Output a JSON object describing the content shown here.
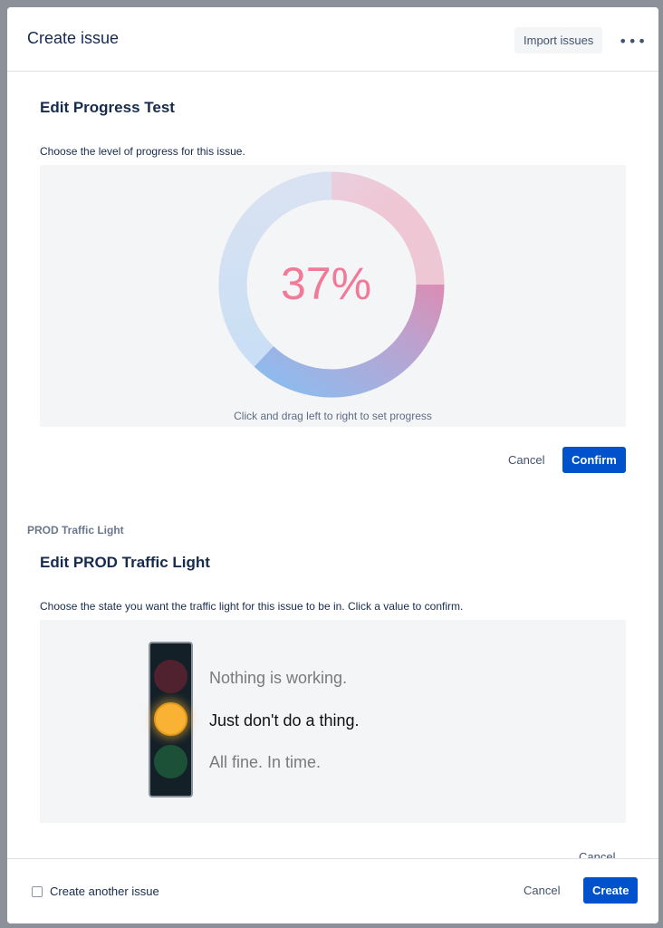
{
  "header": {
    "title": "Create issue",
    "import_label": "Import issues",
    "more_label": "•••"
  },
  "progress_section": {
    "title": "Edit Progress Test",
    "description": "Choose the level of progress for this issue.",
    "value_text": "37%",
    "progress_value": 0.37,
    "hint": "Click and drag left to right to set progress",
    "cancel_label": "Cancel",
    "confirm_label": "Confirm",
    "colors": {
      "text": "#f07a98",
      "pink": "#f0c9d6",
      "blue": "#8cbcef"
    }
  },
  "traffic_section": {
    "field_label": "PROD Traffic Light",
    "title": "Edit PROD Traffic Light",
    "description": "Choose the state you want the traffic light for this issue to be in. Click a value to confirm.",
    "options": [
      "Nothing is working.",
      "Just don't do a thing.",
      "All fine. In time."
    ],
    "selected_index": 1,
    "cancel_label": "Cancel",
    "colors": {
      "red": "#5a2330",
      "amber": "#f9b233",
      "green": "#1f5a3a"
    }
  },
  "footer": {
    "create_another_label": "Create another issue",
    "cancel_label": "Cancel",
    "create_label": "Create"
  }
}
